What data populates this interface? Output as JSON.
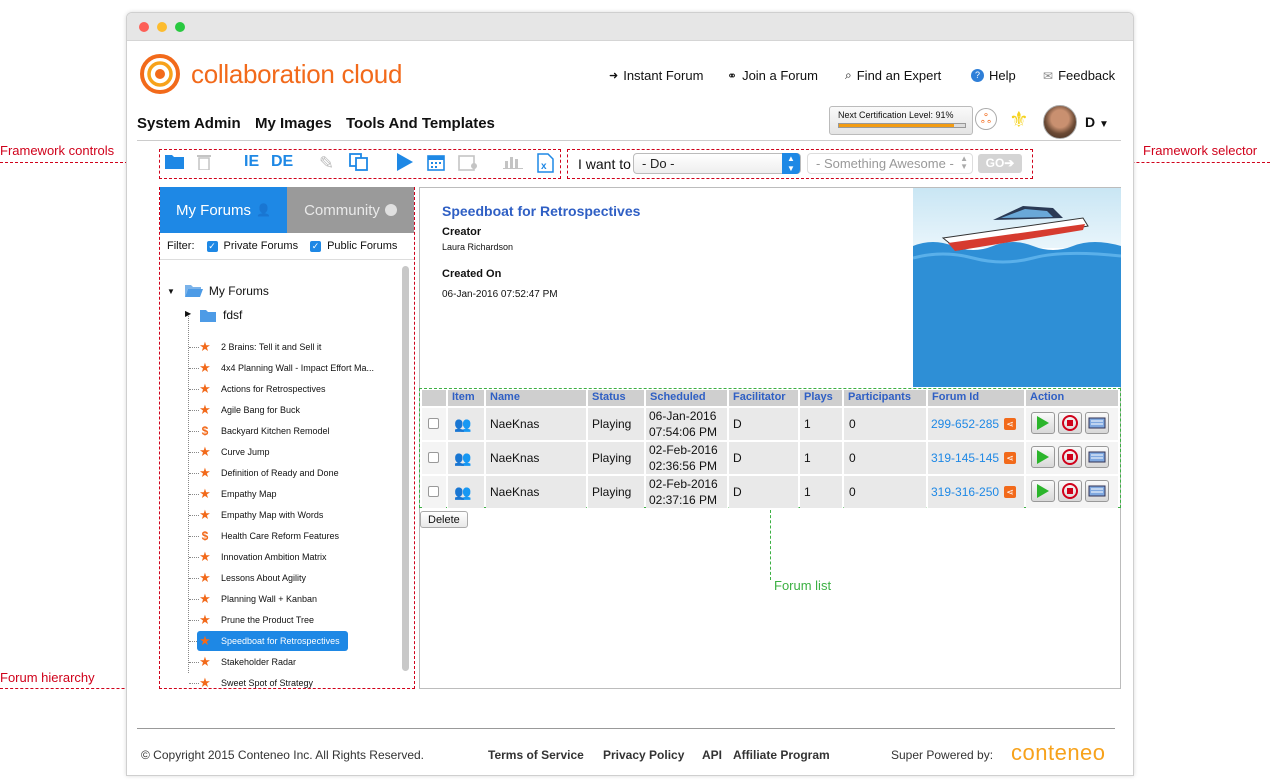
{
  "annotations": {
    "framework_controls": "Framework controls",
    "framework_selector": "Framework selector",
    "forum_hierarchy": "Forum hierarchy",
    "forum_list": "Forum list"
  },
  "header": {
    "logo_text": "collaboration cloud",
    "nav": [
      {
        "label": "Instant Forum",
        "icon": "arrow-circle-icon"
      },
      {
        "label": "Join a Forum",
        "icon": "link-icon"
      },
      {
        "label": "Find an Expert",
        "icon": "search-icon"
      },
      {
        "label": "Help",
        "icon": "help-icon"
      },
      {
        "label": "Feedback",
        "icon": "envelope-icon"
      }
    ],
    "main_nav": [
      "System Admin",
      "My Images",
      "Tools And Templates"
    ],
    "certification_label": "Next Certification Level: 91%",
    "certification_progress": 91,
    "user_initial": "D"
  },
  "toolbar": {
    "want_label": "I want to",
    "do_select": "- Do -",
    "something_select": "- Something Awesome -",
    "go_label": "GO"
  },
  "left_panel": {
    "tab_my_forums": "My Forums",
    "tab_community": "Community",
    "filter_label": "Filter:",
    "filter_private": "Private Forums",
    "filter_public": "Public Forums",
    "root": "My Forums",
    "folder": "fdsf",
    "items": [
      {
        "label": "2 Brains: Tell it and Sell it",
        "icon": "star"
      },
      {
        "label": "4x4 Planning Wall - Impact Effort Ma...",
        "icon": "star"
      },
      {
        "label": "Actions for Retrospectives",
        "icon": "star"
      },
      {
        "label": "Agile Bang for Buck",
        "icon": "star"
      },
      {
        "label": "Backyard Kitchen Remodel",
        "icon": "dollar"
      },
      {
        "label": "Curve Jump",
        "icon": "star"
      },
      {
        "label": "Definition of Ready and Done",
        "icon": "star"
      },
      {
        "label": "Empathy Map",
        "icon": "star"
      },
      {
        "label": "Empathy Map with Words",
        "icon": "star"
      },
      {
        "label": "Health Care Reform Features",
        "icon": "dollar"
      },
      {
        "label": "Innovation Ambition Matrix",
        "icon": "star"
      },
      {
        "label": "Lessons About Agility",
        "icon": "star"
      },
      {
        "label": "Planning Wall + Kanban",
        "icon": "star"
      },
      {
        "label": "Prune the Product Tree",
        "icon": "star"
      },
      {
        "label": "Speedboat for Retrospectives",
        "icon": "star"
      },
      {
        "label": "Stakeholder Radar",
        "icon": "star"
      },
      {
        "label": "Sweet Spot of Strategy",
        "icon": "star"
      }
    ]
  },
  "detail": {
    "title": "Speedboat for Retrospectives",
    "creator_label": "Creator",
    "creator": "Laura Richardson",
    "created_label": "Created On",
    "created": "06-Jan-2016 07:52:47 PM"
  },
  "table": {
    "headers": [
      "Item",
      "Name",
      "Status",
      "Scheduled",
      "Facilitator",
      "Plays",
      "Participants",
      "Forum Id",
      "Action"
    ],
    "rows": [
      {
        "name": "NaeKnas",
        "status": "Playing",
        "date": "06-Jan-2016",
        "time": "07:54:06 PM",
        "facilitator": "D",
        "plays": "1",
        "participants": "0",
        "forum_id": "299-652-285"
      },
      {
        "name": "NaeKnas",
        "status": "Playing",
        "date": "02-Feb-2016",
        "time": "02:36:56 PM",
        "facilitator": "D",
        "plays": "1",
        "participants": "0",
        "forum_id": "319-145-145"
      },
      {
        "name": "NaeKnas",
        "status": "Playing",
        "date": "02-Feb-2016",
        "time": "02:37:16 PM",
        "facilitator": "D",
        "plays": "1",
        "participants": "0",
        "forum_id": "319-316-250"
      }
    ],
    "delete_label": "Delete"
  },
  "footer": {
    "copyright": "© Copyright 2015 Conteneo Inc. All Rights Reserved.",
    "links": [
      "Terms of Service",
      "Privacy Policy",
      "API",
      "Affiliate Program"
    ],
    "powered": "Super Powered by:",
    "brand": "conteneo"
  },
  "colors": {
    "accent": "#1e88e5",
    "brand": "#f26a1b",
    "annotation": "#d0021b",
    "annotation_green": "#3cb043"
  }
}
